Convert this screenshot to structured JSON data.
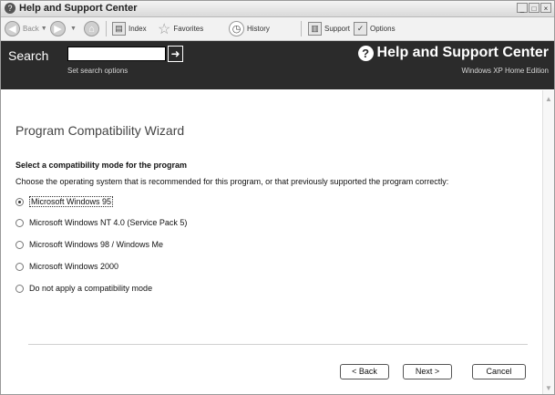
{
  "window": {
    "title": "Help and Support Center"
  },
  "toolbar": {
    "back": "Back",
    "index": "Index",
    "favorites": "Favorites",
    "history": "History",
    "support": "Support",
    "options": "Options"
  },
  "header": {
    "search_label": "Search",
    "search_value": "",
    "set_search_options": "Set search options",
    "center_title": "Help and Support Center",
    "edition": "Windows XP Home Edition"
  },
  "wizard": {
    "title": "Program Compatibility Wizard",
    "heading": "Select a compatibility mode for the program",
    "instruction": "Choose the operating system that is recommended for this program, or that previously supported the program correctly:",
    "options": [
      {
        "label": "Microsoft Windows 95",
        "selected": true
      },
      {
        "label": "Microsoft Windows NT 4.0 (Service Pack 5)",
        "selected": false
      },
      {
        "label": "Microsoft Windows 98 / Windows Me",
        "selected": false
      },
      {
        "label": "Microsoft Windows 2000",
        "selected": false
      },
      {
        "label": "Do not apply a compatibility mode",
        "selected": false
      }
    ],
    "buttons": {
      "back": "< Back",
      "next": "Next >",
      "cancel": "Cancel"
    }
  }
}
